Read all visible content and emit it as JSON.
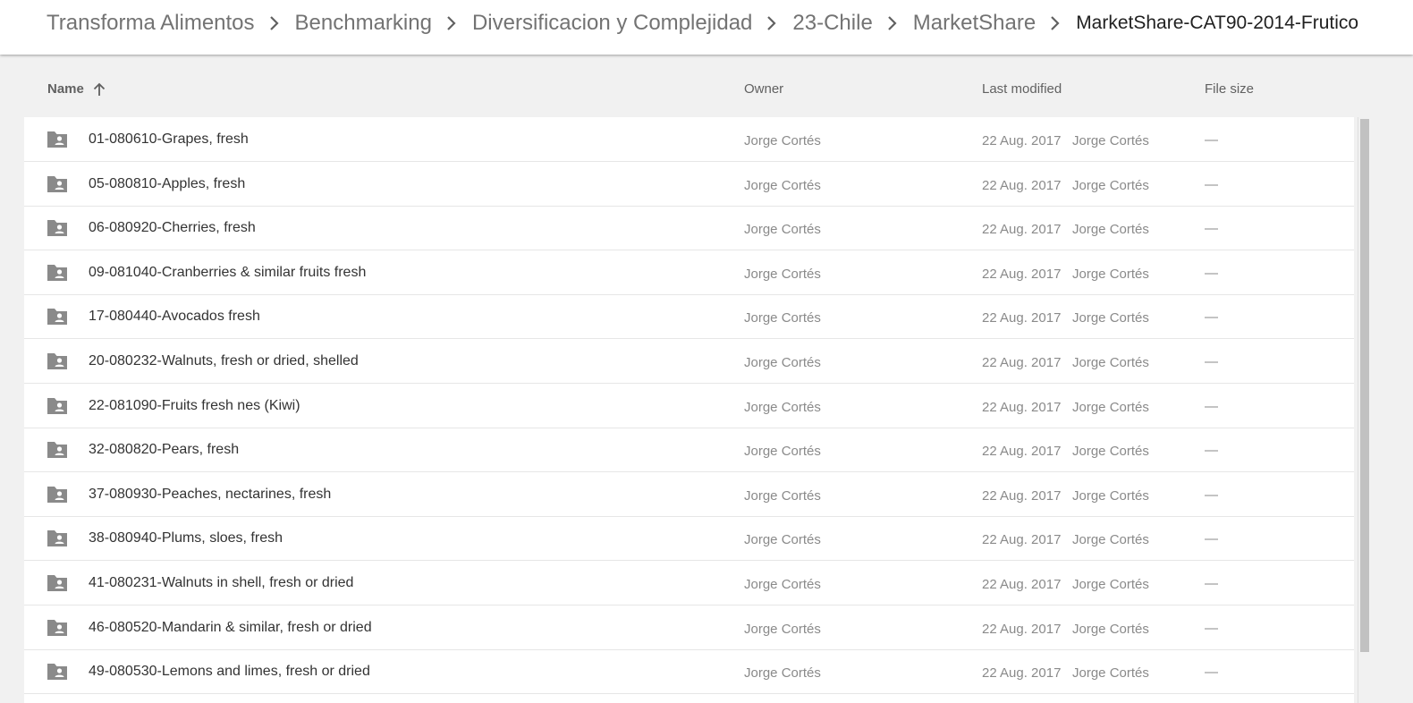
{
  "breadcrumb": {
    "items": [
      {
        "label": "Transforma Alimentos"
      },
      {
        "label": "Benchmarking"
      },
      {
        "label": "Diversificacion y Complejidad"
      },
      {
        "label": "23-Chile"
      },
      {
        "label": "MarketShare"
      }
    ],
    "current": "MarketShare-CAT90-2014-Frutico"
  },
  "columns": {
    "name": "Name",
    "owner": "Owner",
    "last_modified": "Last modified",
    "file_size": "File size"
  },
  "files": [
    {
      "name": "01-080610-Grapes, fresh",
      "owner": "Jorge Cortés",
      "modified_date": "22 Aug. 2017",
      "modified_by": "Jorge Cortés",
      "size": "—",
      "icon": "shared-folder-icon"
    },
    {
      "name": "05-080810-Apples, fresh",
      "owner": "Jorge Cortés",
      "modified_date": "22 Aug. 2017",
      "modified_by": "Jorge Cortés",
      "size": "—",
      "icon": "shared-folder-icon"
    },
    {
      "name": "06-080920-Cherries, fresh",
      "owner": "Jorge Cortés",
      "modified_date": "22 Aug. 2017",
      "modified_by": "Jorge Cortés",
      "size": "—",
      "icon": "shared-folder-icon"
    },
    {
      "name": "09-081040-Cranberries & similar fruits fresh",
      "owner": "Jorge Cortés",
      "modified_date": "22 Aug. 2017",
      "modified_by": "Jorge Cortés",
      "size": "—",
      "icon": "shared-folder-icon"
    },
    {
      "name": "17-080440-Avocados fresh",
      "owner": "Jorge Cortés",
      "modified_date": "22 Aug. 2017",
      "modified_by": "Jorge Cortés",
      "size": "—",
      "icon": "shared-folder-icon"
    },
    {
      "name": "20-080232-Walnuts, fresh or dried, shelled",
      "owner": "Jorge Cortés",
      "modified_date": "22 Aug. 2017",
      "modified_by": "Jorge Cortés",
      "size": "—",
      "icon": "shared-folder-icon"
    },
    {
      "name": "22-081090-Fruits fresh nes (Kiwi)",
      "owner": "Jorge Cortés",
      "modified_date": "22 Aug. 2017",
      "modified_by": "Jorge Cortés",
      "size": "—",
      "icon": "shared-folder-icon"
    },
    {
      "name": "32-080820-Pears, fresh",
      "owner": "Jorge Cortés",
      "modified_date": "22 Aug. 2017",
      "modified_by": "Jorge Cortés",
      "size": "—",
      "icon": "shared-folder-icon"
    },
    {
      "name": "37-080930-Peaches, nectarines, fresh",
      "owner": "Jorge Cortés",
      "modified_date": "22 Aug. 2017",
      "modified_by": "Jorge Cortés",
      "size": "—",
      "icon": "shared-folder-icon"
    },
    {
      "name": "38-080940-Plums, sloes, fresh",
      "owner": "Jorge Cortés",
      "modified_date": "22 Aug. 2017",
      "modified_by": "Jorge Cortés",
      "size": "—",
      "icon": "shared-folder-icon"
    },
    {
      "name": "41-080231-Walnuts in shell, fresh or dried",
      "owner": "Jorge Cortés",
      "modified_date": "22 Aug. 2017",
      "modified_by": "Jorge Cortés",
      "size": "—",
      "icon": "shared-folder-icon"
    },
    {
      "name": "46-080520-Mandarin & similar, fresh or dried",
      "owner": "Jorge Cortés",
      "modified_date": "22 Aug. 2017",
      "modified_by": "Jorge Cortés",
      "size": "—",
      "icon": "shared-folder-icon"
    },
    {
      "name": "49-080530-Lemons and limes, fresh or dried",
      "owner": "Jorge Cortés",
      "modified_date": "22 Aug. 2017",
      "modified_by": "Jorge Cortés",
      "size": "—",
      "icon": "shared-folder-icon"
    }
  ],
  "icons": {
    "separator": "chevron-right-icon",
    "sort": "arrow-up-icon",
    "folder": "shared-folder-icon"
  },
  "colors": {
    "folder_icon": "#8a8a8a",
    "breadcrumb_text": "#737373",
    "current_text": "#212121"
  }
}
